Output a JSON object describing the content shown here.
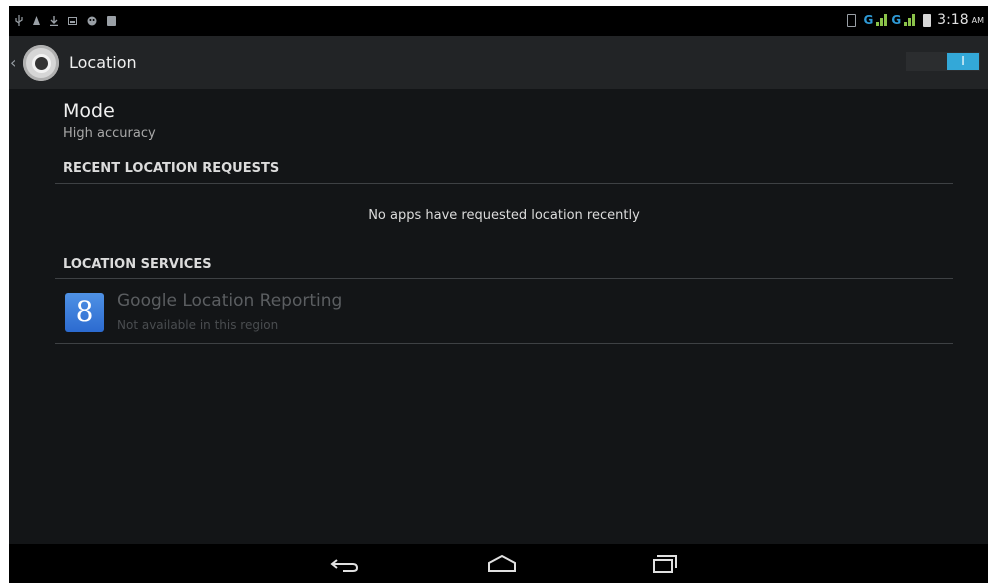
{
  "status_bar": {
    "time": "3:18",
    "ampm": "AM",
    "network_1": "G",
    "network_2": "G",
    "left_icons": [
      "usb-icon",
      "notification-icon",
      "download-icon",
      "screenshot-icon",
      "android-icon",
      "sd-card-icon"
    ],
    "colors": {
      "signal": "#2f9ad6",
      "bars": "#8bc34a"
    }
  },
  "action_bar": {
    "title": "Location",
    "switch_label": "I",
    "switch_on": true,
    "accent": "#33a8d8"
  },
  "mode": {
    "title": "Mode",
    "value": "High accuracy"
  },
  "recent_requests": {
    "header": "RECENT LOCATION REQUESTS",
    "empty_text": "No apps have requested location recently"
  },
  "location_services": {
    "header": "LOCATION SERVICES",
    "items": [
      {
        "icon": "google-icon",
        "icon_glyph": "8",
        "title": "Google Location Reporting",
        "subtitle": "Not available in this region"
      }
    ]
  },
  "nav_bar": {
    "buttons": [
      "back-icon",
      "home-icon",
      "recents-icon"
    ]
  }
}
